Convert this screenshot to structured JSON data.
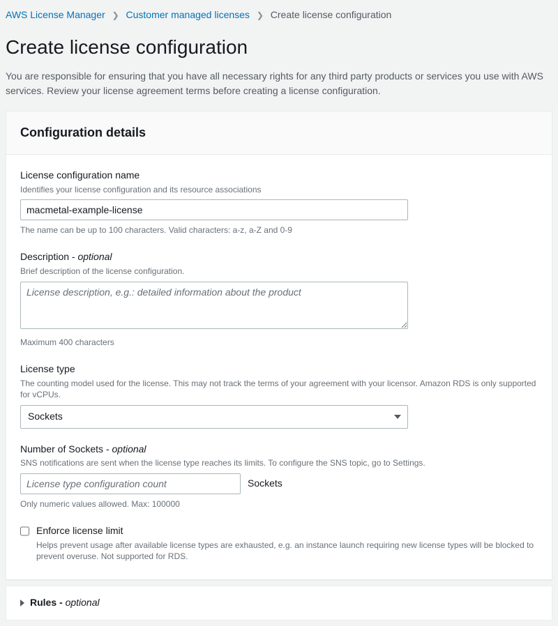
{
  "breadcrumb": {
    "root": "AWS License Manager",
    "mid": "Customer managed licenses",
    "current": "Create license configuration"
  },
  "page": {
    "title": "Create license configuration",
    "description": "You are responsible for ensuring that you have all necessary rights for any third party products or services you use with AWS services. Review your license agreement terms before creating a license configuration."
  },
  "panel": {
    "header": "Configuration details",
    "name": {
      "label": "License configuration name",
      "help": "Identifies your license configuration and its resource associations",
      "value": "macmetal-example-license",
      "hint": "The name can be up to 100 characters. Valid characters: a-z, a-Z and 0-9"
    },
    "description": {
      "label_main": "Description - ",
      "label_optional": "optional",
      "help": "Brief description of the license configuration.",
      "placeholder": "License description, e.g.: detailed information about the product",
      "value": "",
      "hint": "Maximum 400 characters"
    },
    "license_type": {
      "label": "License type",
      "help": "The counting model used for the license. This may not track the terms of your agreement with your licensor. Amazon RDS is only supported for vCPUs.",
      "selected": "Sockets"
    },
    "sockets": {
      "label_main": "Number of Sockets - ",
      "label_optional": "optional",
      "help": "SNS notifications are sent when the license type reaches its limits. To configure the SNS topic, go to Settings.",
      "placeholder": "License type configuration count",
      "value": "",
      "suffix": "Sockets",
      "hint": "Only numeric values allowed. Max: 100000"
    },
    "enforce": {
      "label": "Enforce license limit",
      "help": "Helps prevent usage after available license types are exhausted, e.g. an instance launch requiring new license types will be blocked to prevent overuse. Not supported for RDS.",
      "checked": false
    }
  },
  "rules": {
    "label_main": "Rules - ",
    "label_optional": "optional"
  }
}
